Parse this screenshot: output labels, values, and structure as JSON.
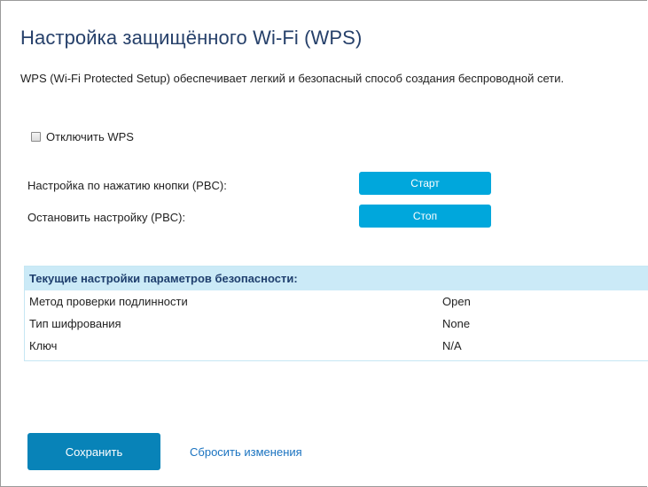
{
  "page": {
    "title": "Настройка защищённого Wi-Fi (WPS)",
    "description": "WPS (Wi-Fi Protected Setup) обеспечивает легкий и безопасный способ создания беспроводной сети."
  },
  "wps_toggle": {
    "label": "Отключить WPS",
    "checked": false
  },
  "pbc": {
    "start_label": "Настройка по нажатию кнопки (PBC):",
    "start_button": "Старт",
    "stop_label": "Остановить настройку (PBC):",
    "stop_button": "Стоп"
  },
  "security": {
    "header": "Текущие настройки параметров безопасности:",
    "rows": [
      {
        "label": "Метод проверки подлинности",
        "value": "Open"
      },
      {
        "label": "Тип шифрования",
        "value": "None"
      },
      {
        "label": "Ключ",
        "value": "N/A"
      }
    ]
  },
  "footer": {
    "save_button": "Сохранить",
    "reset_link": "Сбросить изменения"
  },
  "colors": {
    "title": "#26406a",
    "button_accent": "#00a7dc",
    "save_button": "#0883b8",
    "panel_header_bg": "#cbeaf7",
    "link": "#1a73c0"
  }
}
